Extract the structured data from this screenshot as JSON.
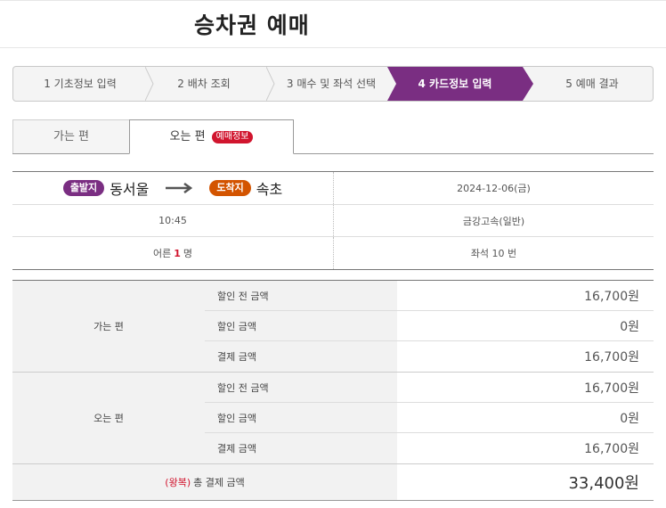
{
  "title": "승차권 예매",
  "steps": [
    {
      "label": "1 기초정보 입력"
    },
    {
      "label": "2 배차 조회"
    },
    {
      "label": "3 매수 및 좌석 선택"
    },
    {
      "label": "4 카드정보 입력"
    },
    {
      "label": "5 예매 결과"
    }
  ],
  "active_step": 3,
  "tabs": {
    "outbound": "가는 편",
    "return": "오는 편",
    "return_badge": "예매정보"
  },
  "route": {
    "dep_label": "출발지",
    "dep_city": "동서울",
    "arrow": "⟶",
    "arr_label": "도착지",
    "arr_city": "속초",
    "date": "2024-12-06(금)",
    "time": "10:45",
    "bus_company": "금강고속(일반)",
    "passenger_prefix": "어른",
    "passenger_count": "1",
    "passenger_suffix": "명",
    "seat": "좌석 10 번"
  },
  "fare": {
    "groups": [
      {
        "label": "가는 편",
        "rows": [
          {
            "name": "할인 전 금액",
            "amount": "16,700원"
          },
          {
            "name": "할인 금액",
            "amount": "0원"
          },
          {
            "name": "결제 금액",
            "amount": "16,700원"
          }
        ]
      },
      {
        "label": "오는 편",
        "rows": [
          {
            "name": "할인 전 금액",
            "amount": "16,700원"
          },
          {
            "name": "할인 금액",
            "amount": "0원"
          },
          {
            "name": "결제 금액",
            "amount": "16,700원"
          }
        ]
      }
    ],
    "total_prefix": "(왕복)",
    "total_label": "총 결제 금액",
    "total_amount": "33,400원"
  },
  "colors": {
    "accent": "#7a2e82",
    "departure": "#7a2e82",
    "arrival": "#d35400",
    "highlight_red": "#d1152e"
  }
}
